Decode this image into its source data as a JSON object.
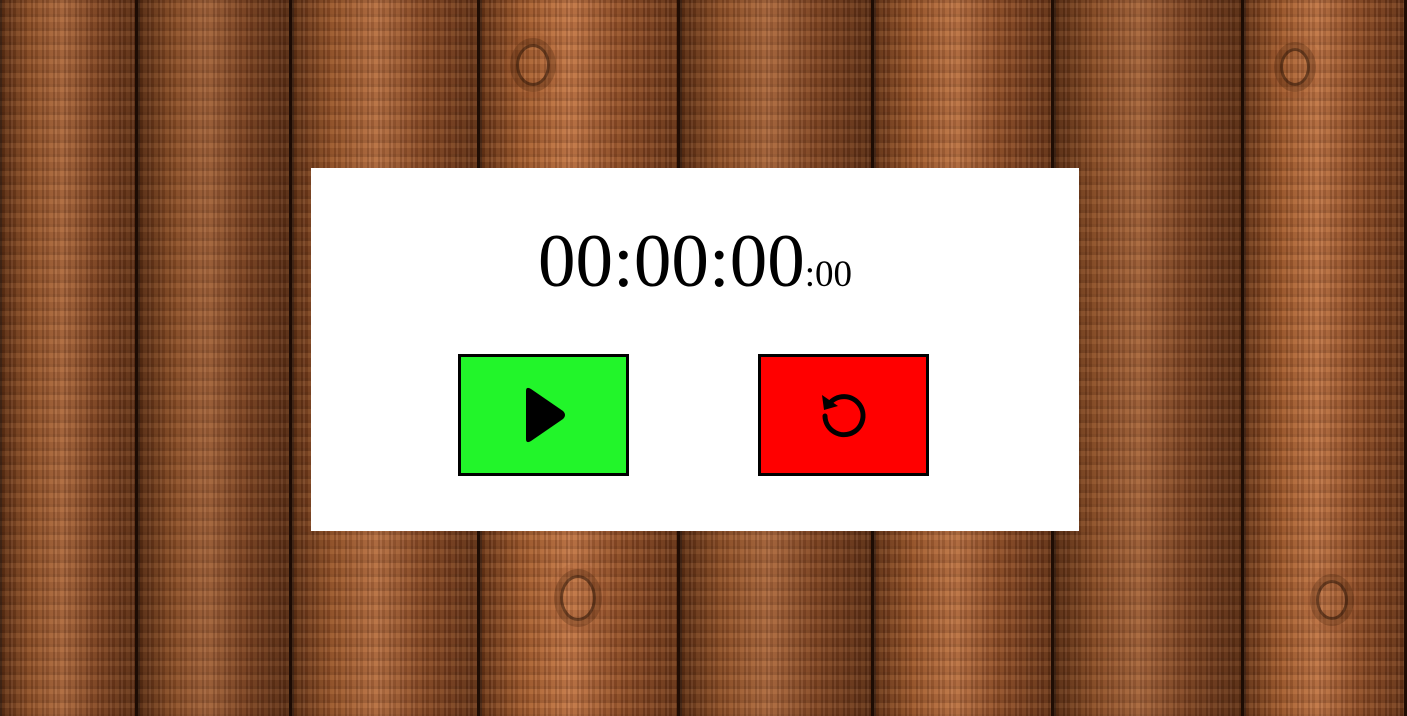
{
  "stopwatch": {
    "time_main": "00:00:00",
    "time_ms": ":00"
  },
  "buttons": {
    "start": {
      "icon": "play-icon",
      "color": "#22f52a"
    },
    "reset": {
      "icon": "reset-icon",
      "color": "#ff0000"
    }
  },
  "background": {
    "style": "wood-planks"
  }
}
